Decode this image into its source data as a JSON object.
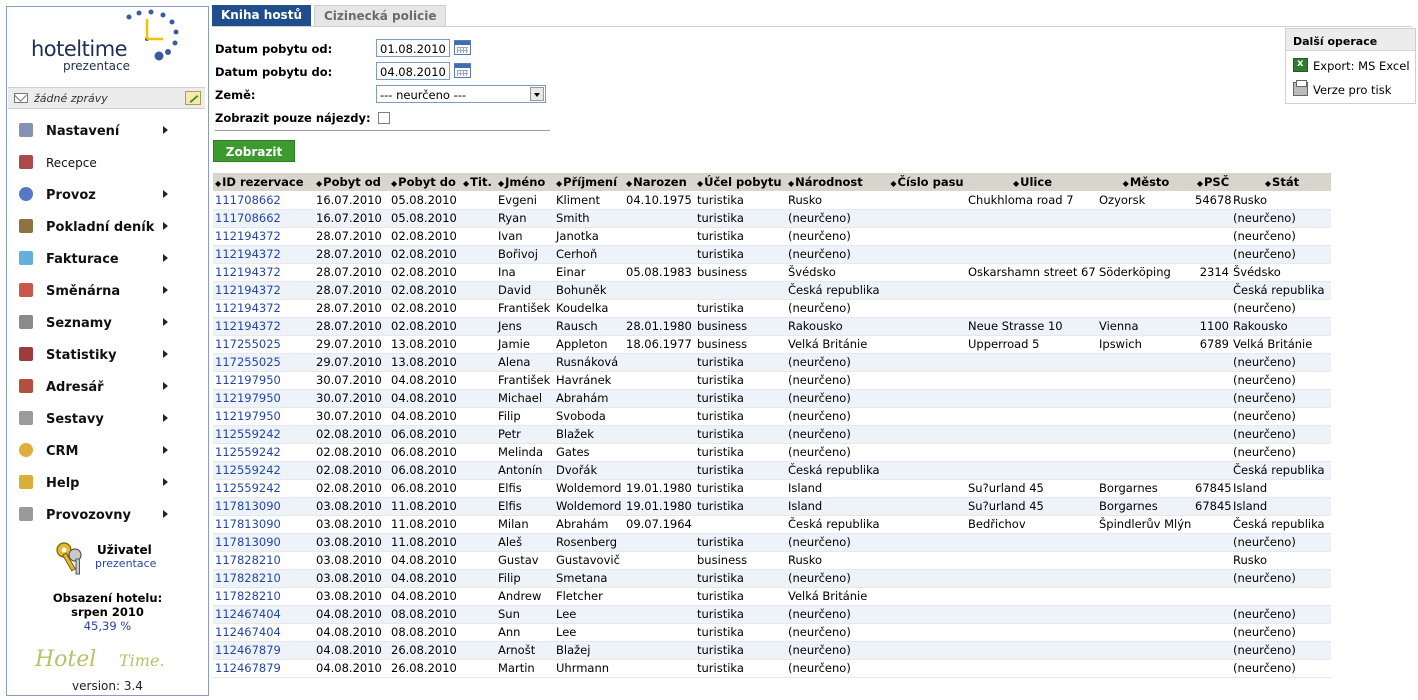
{
  "sidebar": {
    "logo": {
      "brand": "hoteltime",
      "sub": "prezentace"
    },
    "messages": "žádné zprávy",
    "menu": [
      {
        "label": "Nastavení",
        "icon": "settings-icon",
        "arrow": true,
        "bold": true
      },
      {
        "label": "Recepce",
        "icon": "book-icon",
        "arrow": false,
        "bold": false
      },
      {
        "label": "Provoz",
        "icon": "gear-icon",
        "arrow": true,
        "bold": true
      },
      {
        "label": "Pokladní deník",
        "icon": "cash-book-icon",
        "arrow": true,
        "bold": true
      },
      {
        "label": "Fakturace",
        "icon": "invoice-icon",
        "arrow": true,
        "bold": true
      },
      {
        "label": "Směnárna",
        "icon": "flag-icon",
        "arrow": true,
        "bold": true
      },
      {
        "label": "Seznamy",
        "icon": "list-icon",
        "arrow": true,
        "bold": true
      },
      {
        "label": "Statistiky",
        "icon": "chart-icon",
        "arrow": true,
        "bold": true
      },
      {
        "label": "Adresář",
        "icon": "address-book-icon",
        "arrow": true,
        "bold": true
      },
      {
        "label": "Sestavy",
        "icon": "report-icon",
        "arrow": true,
        "bold": true
      },
      {
        "label": "CRM",
        "icon": "crm-icon",
        "arrow": true,
        "bold": true
      },
      {
        "label": "Help",
        "icon": "help-icon",
        "arrow": true,
        "bold": true
      },
      {
        "label": "Provozovny",
        "icon": "building-icon",
        "arrow": true,
        "bold": true
      }
    ],
    "user": {
      "label": "Uživatel",
      "name": "prezentace"
    },
    "occupancy": {
      "label": "Obsazení hotelu:",
      "month": "srpen 2010",
      "value": "45,39 %"
    },
    "brand2": {
      "part1": "Hotel",
      "part2": "Time."
    },
    "version": "version: 3.4"
  },
  "tabs": [
    "Kniha hostů",
    "Cizinecká policie"
  ],
  "form": {
    "date_from_label": "Datum pobytu od:",
    "date_from": "01.08.2010",
    "date_to_label": "Datum pobytu do:",
    "date_to": "04.08.2010",
    "country_label": "Země:",
    "country_value": "--- neurčeno ---",
    "raids_label": "Zobrazit pouze nájezdy:",
    "raids_checked": false,
    "submit": "Zobrazit"
  },
  "ops": {
    "title": "Další operace",
    "items": [
      {
        "label": "Export: MS Excel",
        "icon": "excel-icon"
      },
      {
        "label": "Verze pro tisk",
        "icon": "printer-icon"
      }
    ]
  },
  "table": {
    "columns": [
      "ID rezervace",
      "Pobyt od",
      "Pobyt do",
      "Tit.",
      "Jméno",
      "Příjmení",
      "Narozen",
      "Účel pobytu",
      "Národnost",
      "Číslo pasu",
      "Ulice",
      "Město",
      "PSČ",
      "Stát"
    ],
    "rows": [
      [
        "111708662",
        "16.07.2010",
        "05.08.2010",
        "",
        "Evgeni",
        "Kliment",
        "04.10.1975",
        "turistika",
        "Rusko",
        "",
        "Chukhloma road 7",
        "Ozyorsk",
        "54678",
        "Rusko"
      ],
      [
        "111708662",
        "16.07.2010",
        "05.08.2010",
        "",
        "Ryan",
        "Smith",
        "",
        "turistika",
        "(neurčeno)",
        "",
        "",
        "",
        "",
        "(neurčeno)"
      ],
      [
        "112194372",
        "28.07.2010",
        "02.08.2010",
        "",
        "Ivan",
        "Janotka",
        "",
        "turistika",
        "(neurčeno)",
        "",
        "",
        "",
        "",
        "(neurčeno)"
      ],
      [
        "112194372",
        "28.07.2010",
        "02.08.2010",
        "",
        "Bořivoj",
        "Cerhoň",
        "",
        "turistika",
        "(neurčeno)",
        "",
        "",
        "",
        "",
        "(neurčeno)"
      ],
      [
        "112194372",
        "28.07.2010",
        "02.08.2010",
        "",
        "Ina",
        "Einar",
        "05.08.1983",
        "business",
        "Švédsko",
        "",
        "Oskarshamn street 67",
        "Söderköping",
        "2314",
        "Švédsko"
      ],
      [
        "112194372",
        "28.07.2010",
        "02.08.2010",
        "",
        "David",
        "Bohuněk",
        "",
        "",
        "Česká republika",
        "",
        "",
        "",
        "",
        "Česká republika"
      ],
      [
        "112194372",
        "28.07.2010",
        "02.08.2010",
        "",
        "František",
        "Koudelka",
        "",
        "turistika",
        "(neurčeno)",
        "",
        "",
        "",
        "",
        "(neurčeno)"
      ],
      [
        "112194372",
        "28.07.2010",
        "02.08.2010",
        "",
        "Jens",
        "Rausch",
        "28.01.1980",
        "business",
        "Rakousko",
        "",
        "Neue Strasse 10",
        "Vienna",
        "1100",
        "Rakousko"
      ],
      [
        "117255025",
        "29.07.2010",
        "13.08.2010",
        "",
        "Jamie",
        "Appleton",
        "18.06.1977",
        "business",
        "Velká Británie",
        "",
        "Upperroad 5",
        "Ipswich",
        "6789",
        "Velká Británie"
      ],
      [
        "117255025",
        "29.07.2010",
        "13.08.2010",
        "",
        "Alena",
        "Rusnáková",
        "",
        "turistika",
        "(neurčeno)",
        "",
        "",
        "",
        "",
        "(neurčeno)"
      ],
      [
        "112197950",
        "30.07.2010",
        "04.08.2010",
        "",
        "František",
        "Havránek",
        "",
        "turistika",
        "(neurčeno)",
        "",
        "",
        "",
        "",
        "(neurčeno)"
      ],
      [
        "112197950",
        "30.07.2010",
        "04.08.2010",
        "",
        "Michael",
        "Abrahám",
        "",
        "turistika",
        "(neurčeno)",
        "",
        "",
        "",
        "",
        "(neurčeno)"
      ],
      [
        "112197950",
        "30.07.2010",
        "04.08.2010",
        "",
        "Filip",
        "Svoboda",
        "",
        "turistika",
        "(neurčeno)",
        "",
        "",
        "",
        "",
        "(neurčeno)"
      ],
      [
        "112559242",
        "02.08.2010",
        "06.08.2010",
        "",
        "Petr",
        "Blažek",
        "",
        "turistika",
        "(neurčeno)",
        "",
        "",
        "",
        "",
        "(neurčeno)"
      ],
      [
        "112559242",
        "02.08.2010",
        "06.08.2010",
        "",
        "Melinda",
        "Gates",
        "",
        "turistika",
        "(neurčeno)",
        "",
        "",
        "",
        "",
        "(neurčeno)"
      ],
      [
        "112559242",
        "02.08.2010",
        "06.08.2010",
        "",
        "Antonín",
        "Dvořák",
        "",
        "turistika",
        "Česká republika",
        "",
        "",
        "",
        "",
        "Česká republika"
      ],
      [
        "112559242",
        "02.08.2010",
        "06.08.2010",
        "",
        "Elfis",
        "Woldemord",
        "19.01.1980",
        "turistika",
        "Island",
        "",
        "Su?urland 45",
        "Borgarnes",
        "67845",
        "Island"
      ],
      [
        "117813090",
        "03.08.2010",
        "11.08.2010",
        "",
        "Elfis",
        "Woldemord",
        "19.01.1980",
        "turistika",
        "Island",
        "",
        "Su?urland 45",
        "Borgarnes",
        "67845",
        "Island"
      ],
      [
        "117813090",
        "03.08.2010",
        "11.08.2010",
        "",
        "Milan",
        "Abrahám",
        "09.07.1964",
        "",
        "Česká republika",
        "",
        "Bedřichov",
        "Špindlerův Mlýn",
        "",
        "Česká republika"
      ],
      [
        "117813090",
        "03.08.2010",
        "11.08.2010",
        "",
        "Aleš",
        "Rosenberg",
        "",
        "turistika",
        "(neurčeno)",
        "",
        "",
        "",
        "",
        "(neurčeno)"
      ],
      [
        "117828210",
        "03.08.2010",
        "04.08.2010",
        "",
        "Gustav",
        "Gustavovič",
        "",
        "business",
        "Rusko",
        "",
        "",
        "",
        "",
        "Rusko"
      ],
      [
        "117828210",
        "03.08.2010",
        "04.08.2010",
        "",
        "Filip",
        "Smetana",
        "",
        "turistika",
        "(neurčeno)",
        "",
        "",
        "",
        "",
        "(neurčeno)"
      ],
      [
        "117828210",
        "03.08.2010",
        "04.08.2010",
        "",
        "Andrew",
        "Fletcher",
        "",
        "turistika",
        "Velká Británie",
        "",
        "",
        "",
        "",
        ""
      ],
      [
        "112467404",
        "04.08.2010",
        "08.08.2010",
        "",
        "Sun",
        "Lee",
        "",
        "turistika",
        "(neurčeno)",
        "",
        "",
        "",
        "",
        "(neurčeno)"
      ],
      [
        "112467404",
        "04.08.2010",
        "08.08.2010",
        "",
        "Ann",
        "Lee",
        "",
        "turistika",
        "(neurčeno)",
        "",
        "",
        "",
        "",
        "(neurčeno)"
      ],
      [
        "112467879",
        "04.08.2010",
        "26.08.2010",
        "",
        "Arnošt",
        "Blažej",
        "",
        "turistika",
        "(neurčeno)",
        "",
        "",
        "",
        "",
        "(neurčeno)"
      ],
      [
        "112467879",
        "04.08.2010",
        "26.08.2010",
        "",
        "Martin",
        "Uhrmann",
        "",
        "turistika",
        "(neurčeno)",
        "",
        "",
        "",
        "",
        "(neurčeno)"
      ]
    ]
  },
  "colors": {
    "accent": "#1f4e8c",
    "button": "#3d9a2e",
    "link": "#2445a8",
    "header_bg": "#d8d5cd",
    "row_alt": "#eef3fa"
  }
}
